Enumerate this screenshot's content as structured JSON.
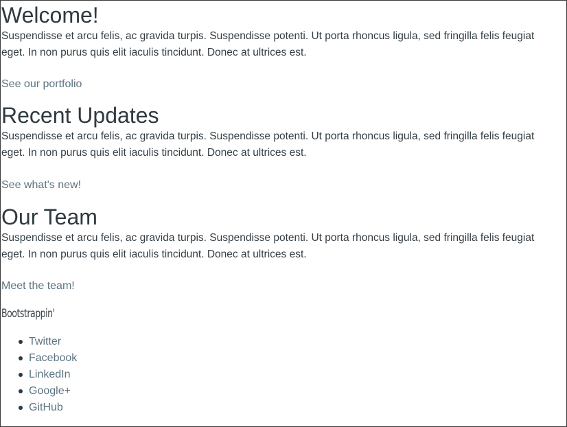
{
  "sections": [
    {
      "heading": "Welcome!",
      "body": "Suspendisse et arcu felis, ac gravida turpis. Suspendisse potenti. Ut porta rhoncus ligula, sed fringilla felis feugiat eget. In non purus quis elit iaculis tincidunt. Donec at ultrices est.",
      "link": "See our portfolio"
    },
    {
      "heading": "Recent Updates",
      "body": "Suspendisse et arcu felis, ac gravida turpis. Suspendisse potenti. Ut porta rhoncus ligula, sed fringilla felis feugiat eget. In non purus quis elit iaculis tincidunt. Donec at ultrices est.",
      "link": "See what's new!"
    },
    {
      "heading": "Our Team",
      "body": "Suspendisse et arcu felis, ac gravida turpis. Suspendisse potenti. Ut porta rhoncus ligula, sed fringilla felis feugiat eget. In non purus quis elit iaculis tincidunt. Donec at ultrices est.",
      "link": "Meet the team!"
    }
  ],
  "footer": {
    "brand": "Bootstrappin'",
    "social_links": [
      "Twitter",
      "Facebook",
      "LinkedIn",
      "Google+",
      "GitHub"
    ]
  },
  "colors": {
    "text": "#333d44",
    "heading": "#2f393f",
    "link": "#5c7482",
    "border": "#3a3a3a",
    "background": "#ffffff"
  }
}
